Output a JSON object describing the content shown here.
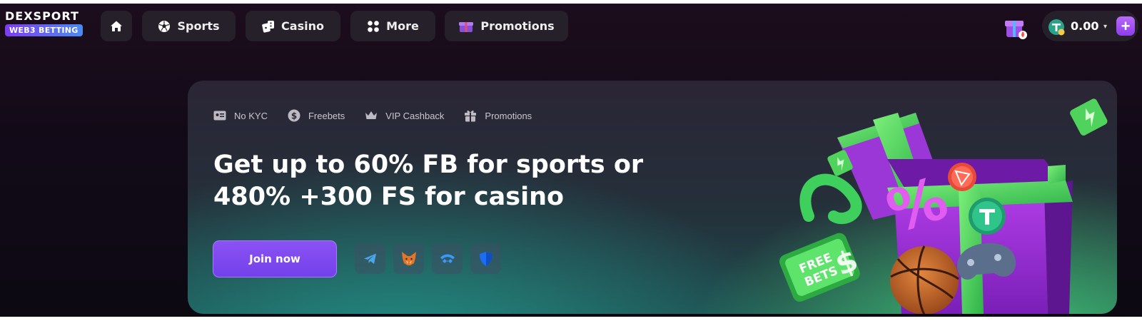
{
  "brand": {
    "name": "DEXSPORT",
    "badge": "WEB3 BETTING"
  },
  "nav": {
    "sports": "Sports",
    "casino": "Casino",
    "more": "More",
    "promotions": "Promotions"
  },
  "wallet": {
    "balance": "0.00",
    "caret": "▾",
    "plus": "+"
  },
  "banner": {
    "features": [
      "No KYC",
      "Freebets",
      "VIP Cashback",
      "Promotions"
    ],
    "headline_line1": "Get up to 60% FB for sports or",
    "headline_line2": "480% +300 FS for casino",
    "cta": "Join now",
    "art_text": {
      "line1": "FREE",
      "line2": "BETS",
      "symbol": "%"
    }
  },
  "colors": {
    "accent": "#7c48ef",
    "nav_bg": "#26202b",
    "green": "#4fd35c"
  },
  "icons": [
    "home-icon",
    "soccer-ball-icon",
    "dice-icon",
    "grid-icon",
    "gift-box-icon",
    "id-card-icon",
    "dollar-coin-icon",
    "crown-icon",
    "gift-icon",
    "telegram-icon",
    "metamask-icon",
    "walletconnect-icon",
    "trust-wallet-icon",
    "tether-icon"
  ]
}
